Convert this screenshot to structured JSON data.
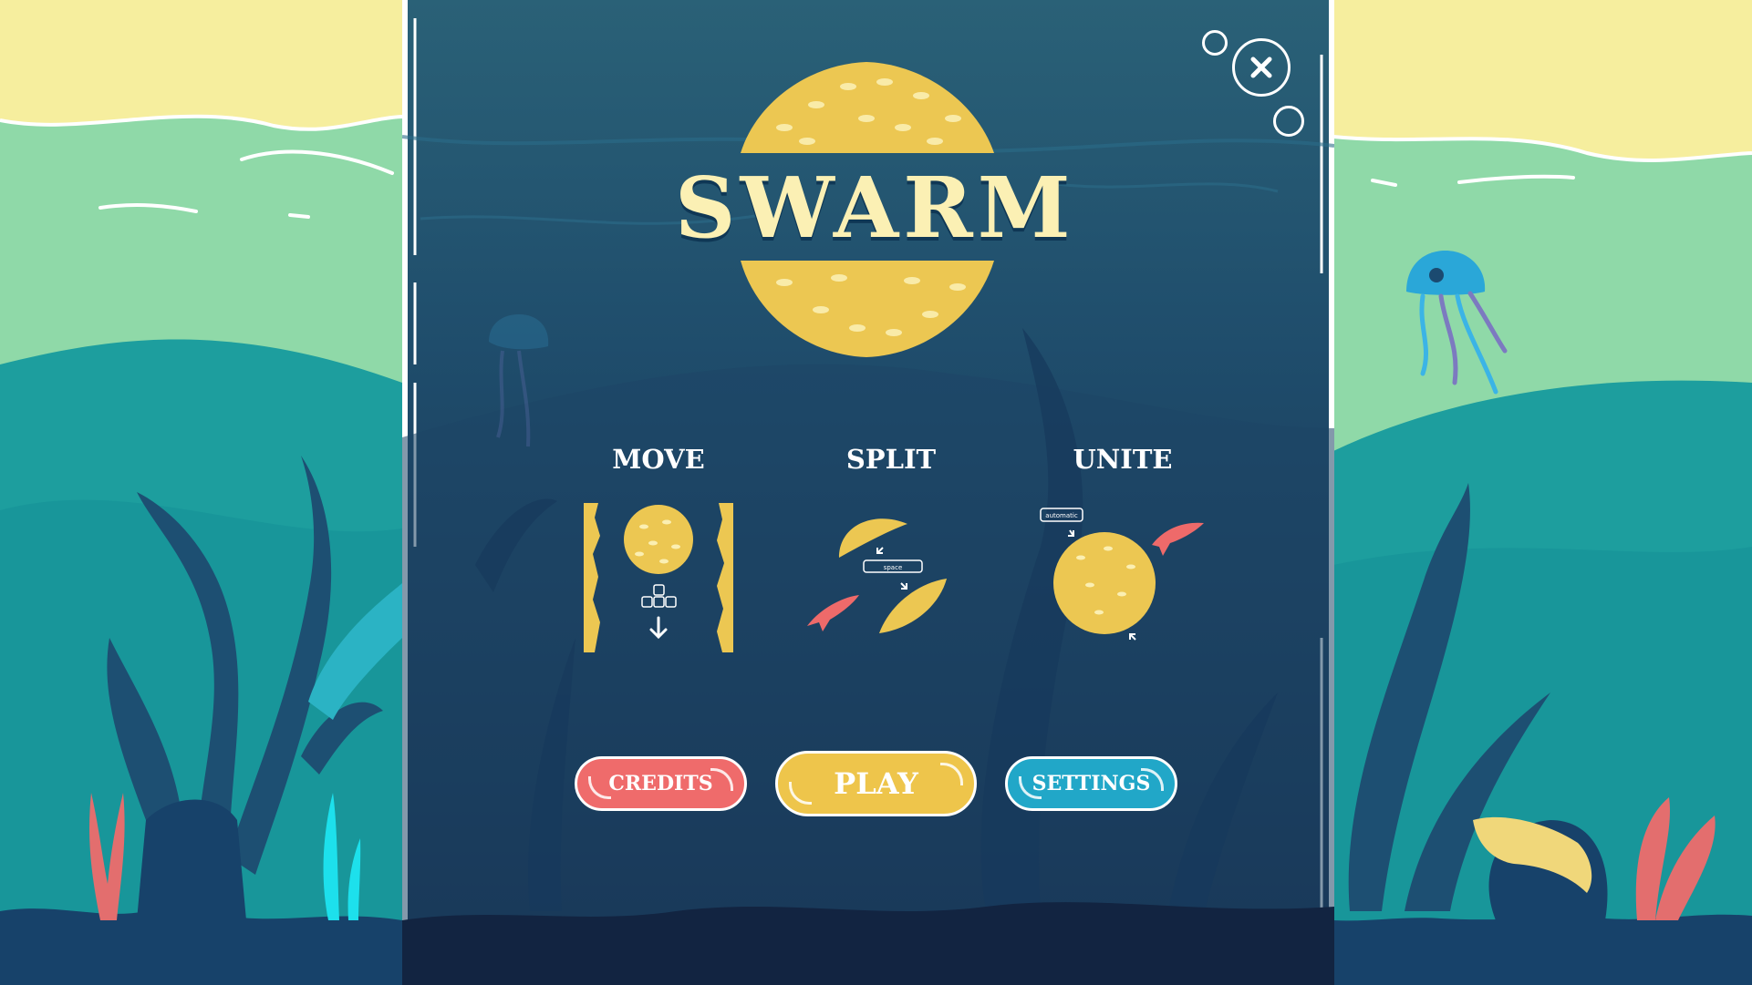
{
  "game": {
    "title": "SWARM"
  },
  "tutorial": {
    "move": {
      "label": "MOVE"
    },
    "split": {
      "label": "SPLIT",
      "key_hint": "space"
    },
    "unite": {
      "label": "UNITE",
      "key_hint": "automatic"
    }
  },
  "menu": {
    "credits_label": "CREDITS",
    "play_label": "PLAY",
    "settings_label": "SETTINGS"
  },
  "icons": {
    "close": "close-icon",
    "move_arrow": "arrow-down-icon",
    "keys": "arrow-keys-icon"
  },
  "colors": {
    "sand": "#f6ee9e",
    "sea_light": "#8fd9a8",
    "sea_mid": "#21a3a3",
    "panel_top": "#2a6177",
    "panel_bottom": "#162b4a",
    "fish_gold": "#ecc752",
    "credits": "#ef6b6b",
    "play": "#eec54b",
    "settings": "#21a7c8",
    "red_fish": "#ee6a6a"
  }
}
